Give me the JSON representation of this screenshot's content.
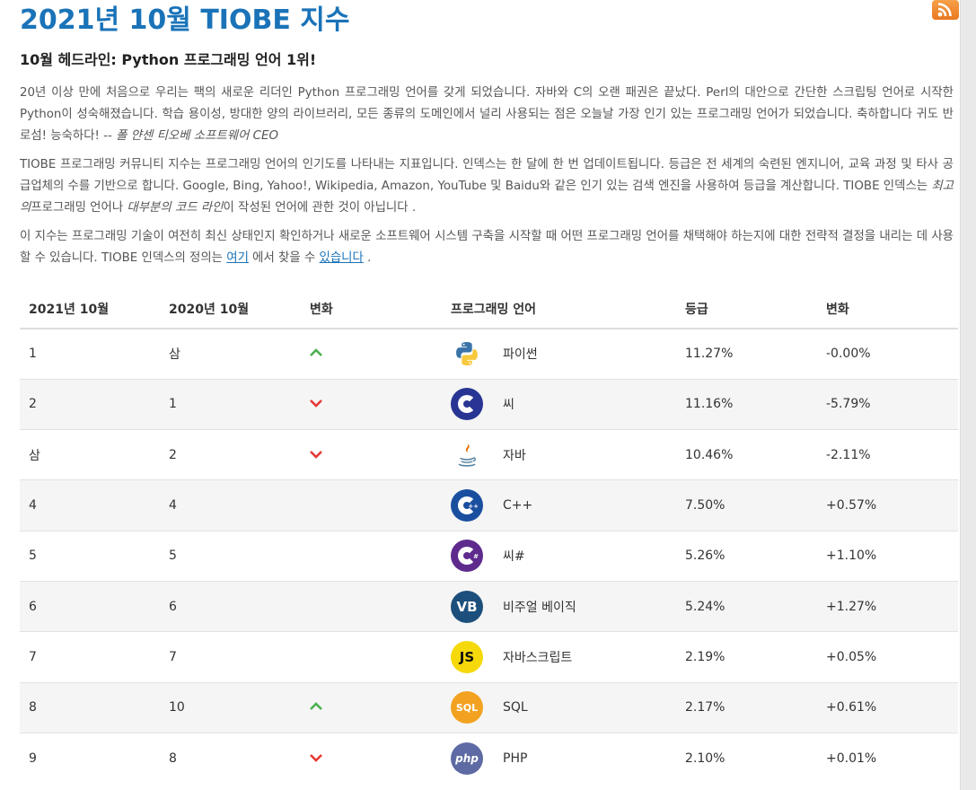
{
  "title": "2021년 10월 TIOBE 지수",
  "headline": "10월 헤드라인: Python 프로그래밍 언어 1위!",
  "para1_text": "20년 이상 만에 처음으로 우리는 팩의 새로운 리더인 Python 프로그래밍 언어를 갖게 되었습니다. 자바와 C의 오랜 패권은 끝났다. Perl의 대안으로 간단한 스크립팅 언어로 시작한 Python이 성숙해졌습니다. 학습 용이성, 방대한 양의 라이브러리, 모든 종류의 도메인에서 널리 사용되는 점은 오늘날 가장 인기 있는 프로그래밍 언어가 되었습니다. 축하합니다 귀도 반 로섬! 능숙하다! --",
  "para1_quote": " 폴 얀센 티오베 소프트웨어 CEO",
  "para2_a": "TIOBE 프로그래밍 커뮤니티 지수는 프로그래밍 언어의 인기도를 나타내는 지표입니다. 인덱스는 한 달에 한 번 업데이트됩니다. 등급은 전 세계의 숙련된 엔지니어, 교육 과정 및 타사 공급업체의 수를 기반으로 합니다. Google, Bing, Yahoo!, Wikipedia, Amazon, YouTube 및 Baidu와 같은 인기 있는 검색 엔진을 사용하여 등급을 계산합니다. TIOBE 인덱스는 ",
  "para2_best": "최고의",
  "para2_b": "프로그래밍 언어나 ",
  "para2_most": "대부분의 코드 라인",
  "para2_c": "이 작성된 언어에 관한 것이 아닙니다 .",
  "para3_a": "이 지수는 프로그래밍 기술이 여전히 최신 상태인지 확인하거나 새로운 소프트웨어 시스템 구축을 시작할 때 어떤 프로그래밍 언어를 채택해야 하는지에 대한 전략적 결정을 내리는 데 사용할 수 있습니다. TIOBE 인덱스의 정의는 ",
  "para3_link1": "여기",
  "para3_b": " 에서 찾을 수 ",
  "para3_link2": "있습니다",
  "para3_c": " .",
  "table": {
    "headers": [
      "2021년 10월",
      "2020년 10월",
      "변화",
      "프로그래밍 언어",
      "등급",
      "변화"
    ],
    "rows": [
      {
        "rank": "1",
        "prev": "삼",
        "change": "up",
        "logo": "python-logo",
        "language": "파이썬",
        "rating": "11.27%",
        "delta": "-0.00%"
      },
      {
        "rank": "2",
        "prev": "1",
        "change": "down",
        "logo": "c-logo",
        "language": "씨",
        "rating": "11.16%",
        "delta": "-5.79%"
      },
      {
        "rank": "삼",
        "prev": "2",
        "change": "down",
        "logo": "java-logo",
        "language": "자바",
        "rating": "10.46%",
        "delta": "-2.11%"
      },
      {
        "rank": "4",
        "prev": "4",
        "change": "",
        "logo": "cpp-logo",
        "language": "C++",
        "rating": "7.50%",
        "delta": "+0.57%"
      },
      {
        "rank": "5",
        "prev": "5",
        "change": "",
        "logo": "csharp-logo",
        "language": "씨#",
        "rating": "5.26%",
        "delta": "+1.10%"
      },
      {
        "rank": "6",
        "prev": "6",
        "change": "",
        "logo": "vb-logo",
        "logo_text": "VB",
        "language": "비주얼 베이직",
        "rating": "5.24%",
        "delta": "+1.27%"
      },
      {
        "rank": "7",
        "prev": "7",
        "change": "",
        "logo": "js-logo",
        "logo_text": "JS",
        "language": "자바스크립트",
        "rating": "2.19%",
        "delta": "+0.05%"
      },
      {
        "rank": "8",
        "prev": "10",
        "change": "up",
        "logo": "sql-logo",
        "logo_text": "SQL",
        "language": "SQL",
        "rating": "2.17%",
        "delta": "+0.61%"
      },
      {
        "rank": "9",
        "prev": "8",
        "change": "down",
        "logo": "php-logo",
        "logo_text": "php",
        "language": "PHP",
        "rating": "2.10%",
        "delta": "+0.01%"
      }
    ]
  },
  "colors": {
    "title": "#1a73b8",
    "up": "#4caf50",
    "down": "#e53935",
    "rss": "#f08a24"
  },
  "icons": {
    "rss": "rss-feed-icon"
  }
}
